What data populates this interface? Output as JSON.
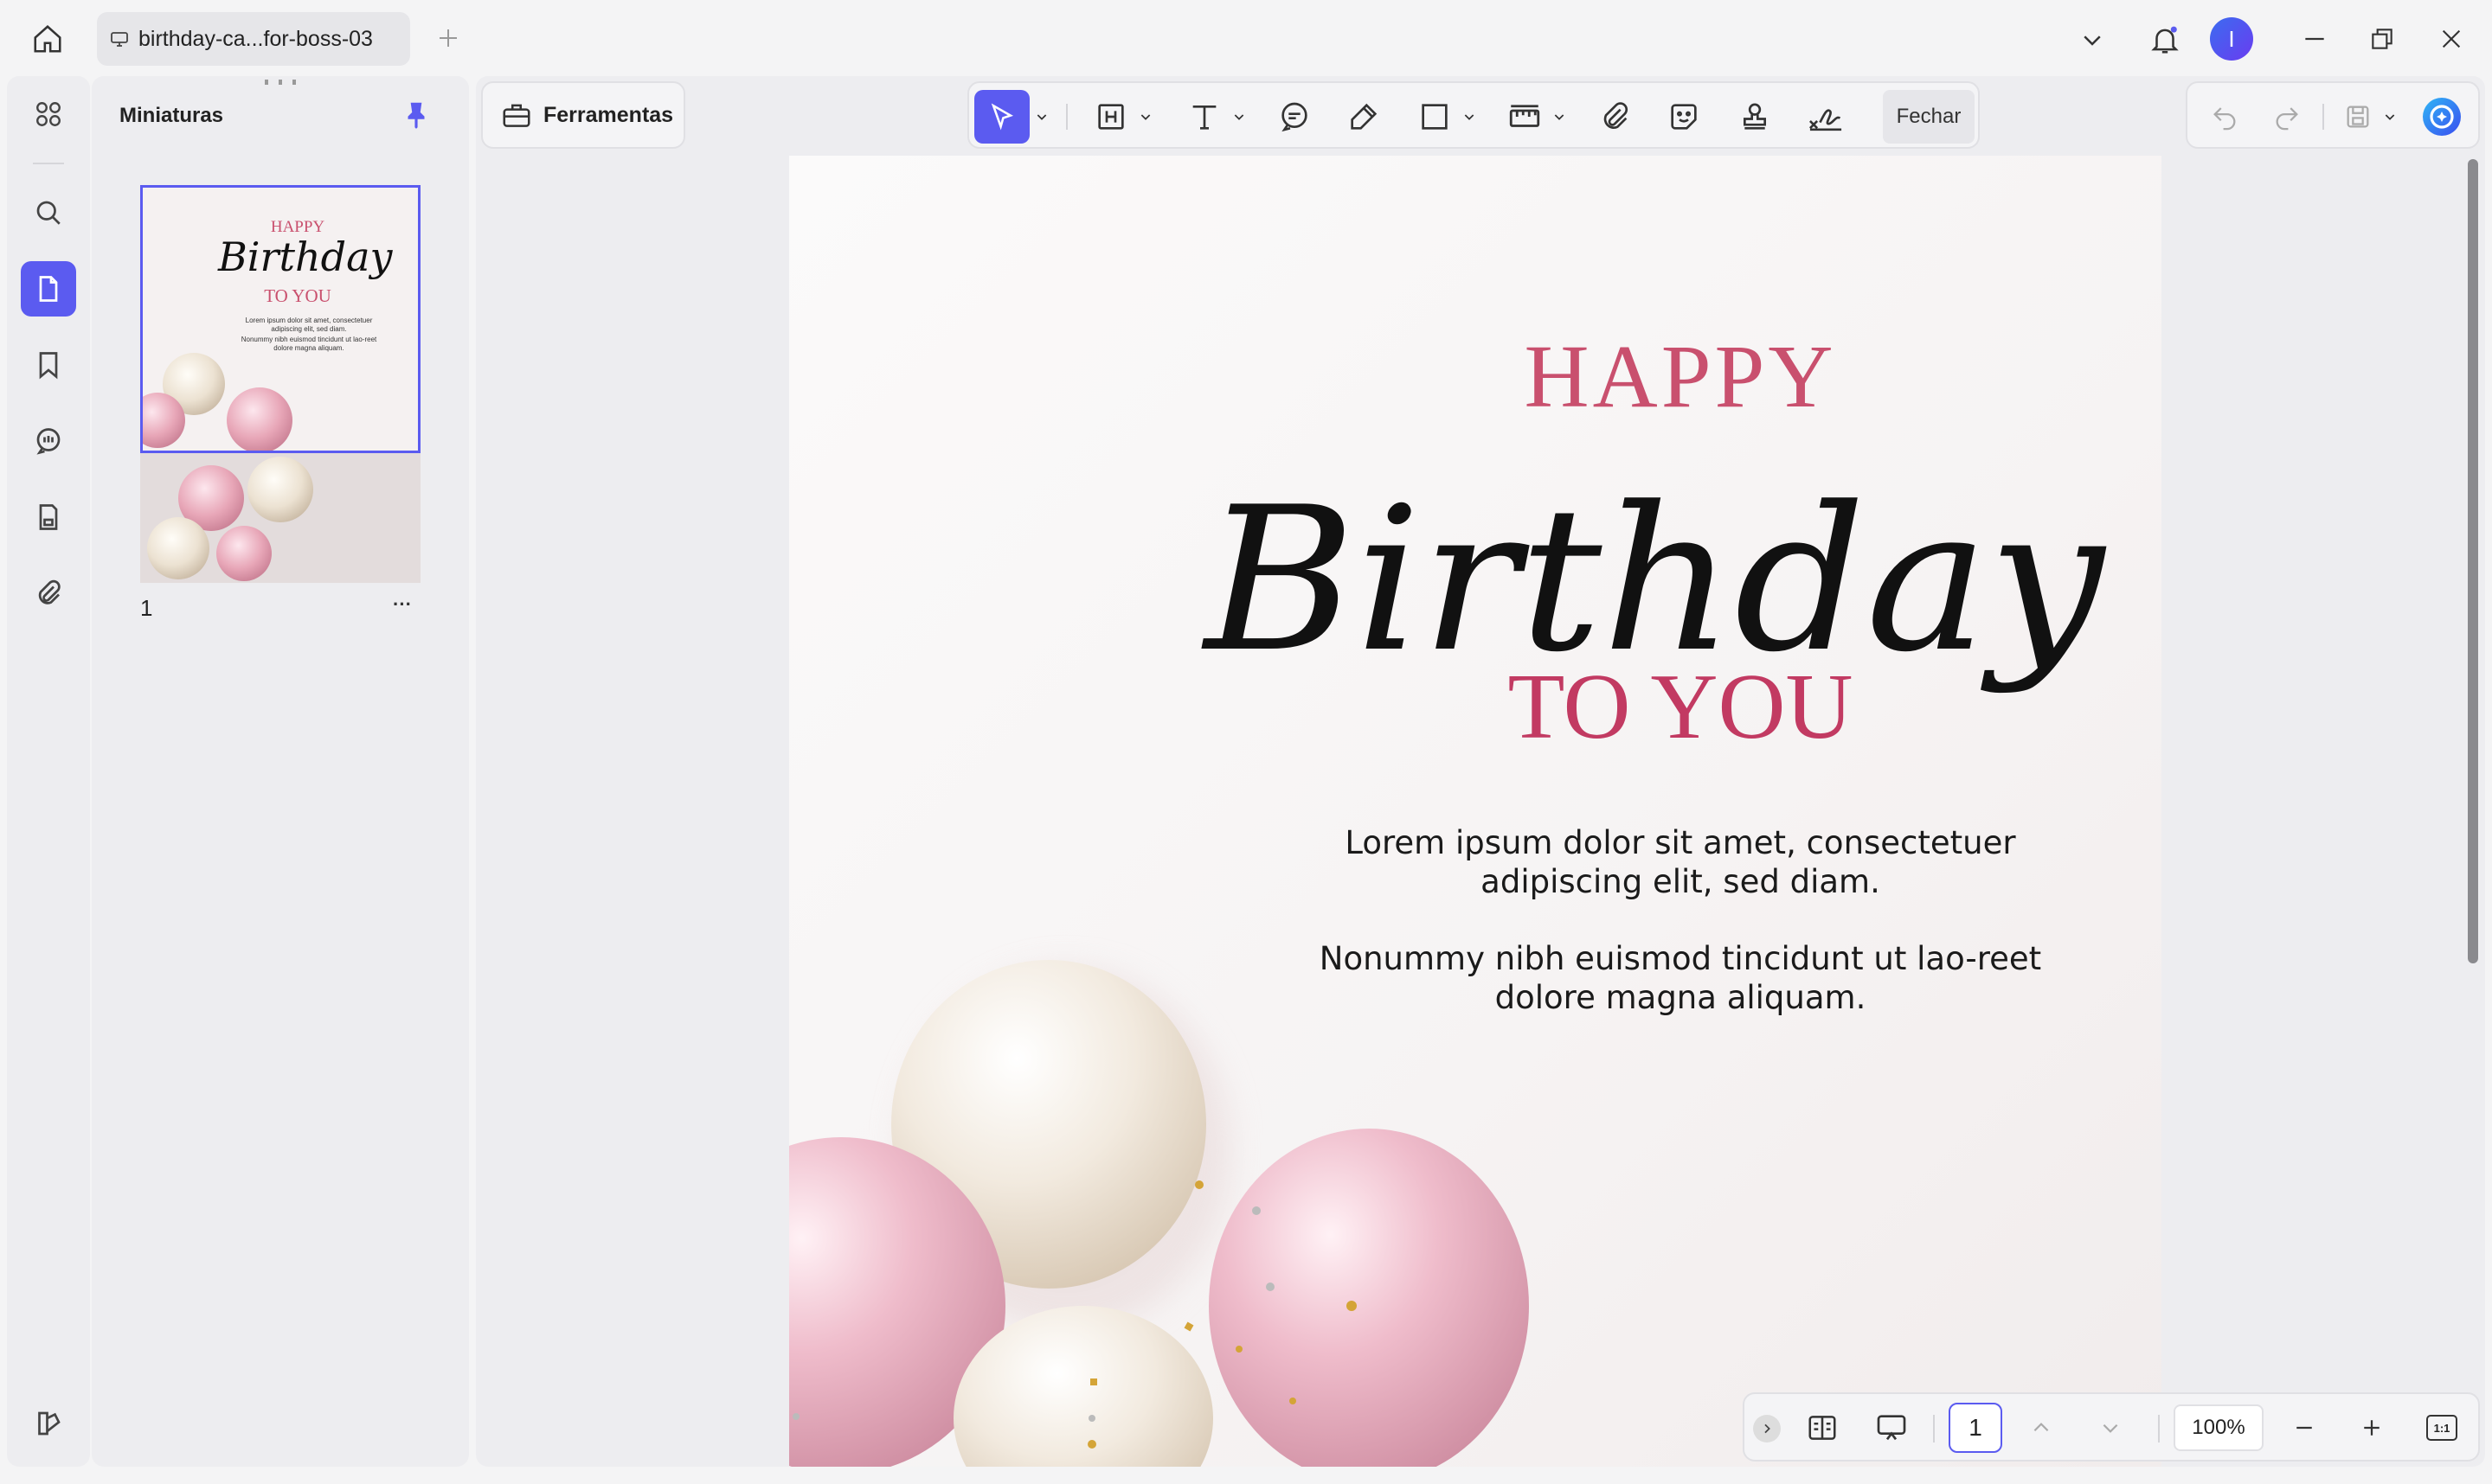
{
  "app": {
    "tab_title": "birthday-ca...for-boss-03",
    "avatar_letter": "I",
    "accent": "#5b5bf0"
  },
  "panel": {
    "title": "Miniaturas",
    "thumb_page_number": "1",
    "more_label": "···"
  },
  "toolbar": {
    "tools_label": "Ferramentas",
    "close_label": "Fechar"
  },
  "document": {
    "happy": "HAPPY",
    "birthday": "Birthday",
    "to_you": "TO YOU",
    "para1": "Lorem ipsum dolor sit amet, consectetuer adipiscing elit, sed diam.",
    "para2": "Nonummy nibh euismod tincidunt ut lao-reet dolore magna aliquam.",
    "pink": "#c9506e"
  },
  "bottom_nav": {
    "page_input": "1",
    "zoom": "100%",
    "fit_label": "1:1"
  }
}
